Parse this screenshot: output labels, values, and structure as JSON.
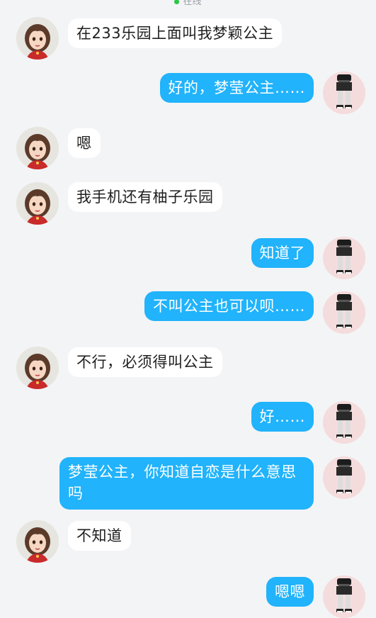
{
  "header": {
    "status_text": "在线",
    "status_color": "#28c840"
  },
  "colors": {
    "incoming_bubble": "#ffffff",
    "outgoing_bubble": "#21b3fb",
    "background": "#f3f4f6"
  },
  "messages": [
    {
      "side": "left",
      "text": "在233乐园上面叫我梦颖公主"
    },
    {
      "side": "right",
      "text": "好的，梦莹公主……"
    },
    {
      "side": "left",
      "text": "嗯"
    },
    {
      "side": "left",
      "text": "我手机还有柚子乐园"
    },
    {
      "side": "right",
      "text": "知道了"
    },
    {
      "side": "right",
      "text": "不叫公主也可以呗……"
    },
    {
      "side": "left",
      "text": "不行，必须得叫公主"
    },
    {
      "side": "right",
      "text": "好……"
    },
    {
      "side": "right",
      "text": "梦莹公主，你知道自恋是什么意思吗"
    },
    {
      "side": "left",
      "text": "不知道"
    },
    {
      "side": "right",
      "text": "嗯嗯"
    }
  ]
}
